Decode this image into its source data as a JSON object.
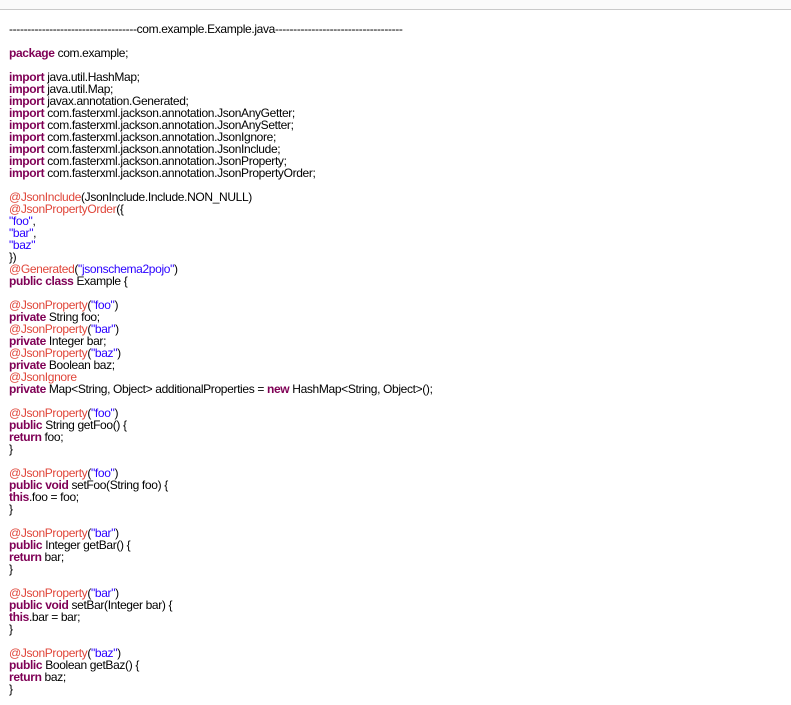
{
  "colors": {
    "keyword": "#7f0055",
    "annotation": "#e0463a",
    "string": "#2a00ff",
    "text": "#000000"
  },
  "lines": [
    [
      [
        "hd",
        "-----------------------------------com.example.Example.java-----------------------------------"
      ]
    ],
    [],
    [
      [
        "kw",
        "package"
      ],
      [
        "tx",
        " com.example;"
      ]
    ],
    [],
    [
      [
        "kw",
        "import"
      ],
      [
        "tx",
        " java.util.HashMap;"
      ]
    ],
    [
      [
        "kw",
        "import"
      ],
      [
        "tx",
        " java.util.Map;"
      ]
    ],
    [
      [
        "kw",
        "import"
      ],
      [
        "tx",
        " javax.annotation.Generated;"
      ]
    ],
    [
      [
        "kw",
        "import"
      ],
      [
        "tx",
        " com.fasterxml.jackson.annotation.JsonAnyGetter;"
      ]
    ],
    [
      [
        "kw",
        "import"
      ],
      [
        "tx",
        " com.fasterxml.jackson.annotation.JsonAnySetter;"
      ]
    ],
    [
      [
        "kw",
        "import"
      ],
      [
        "tx",
        " com.fasterxml.jackson.annotation.JsonIgnore;"
      ]
    ],
    [
      [
        "kw",
        "import"
      ],
      [
        "tx",
        " com.fasterxml.jackson.annotation.JsonInclude;"
      ]
    ],
    [
      [
        "kw",
        "import"
      ],
      [
        "tx",
        " com.fasterxml.jackson.annotation.JsonProperty;"
      ]
    ],
    [
      [
        "kw",
        "import"
      ],
      [
        "tx",
        " com.fasterxml.jackson.annotation.JsonPropertyOrder;"
      ]
    ],
    [],
    [
      [
        "an",
        "@JsonInclude"
      ],
      [
        "tx",
        "(JsonInclude.Include.NON_NULL)"
      ]
    ],
    [
      [
        "an",
        "@JsonPropertyOrder"
      ],
      [
        "tx",
        "({"
      ]
    ],
    [
      [
        "st",
        "\"foo\""
      ],
      [
        "tx",
        ","
      ]
    ],
    [
      [
        "st",
        "\"bar\""
      ],
      [
        "tx",
        ","
      ]
    ],
    [
      [
        "st",
        "\"baz\""
      ]
    ],
    [
      [
        "tx",
        "})"
      ]
    ],
    [
      [
        "an",
        "@Generated"
      ],
      [
        "tx",
        "("
      ],
      [
        "st",
        "\"jsonschema2pojo\""
      ],
      [
        "tx",
        ")"
      ]
    ],
    [
      [
        "kw",
        "public class"
      ],
      [
        "tx",
        " Example {"
      ]
    ],
    [],
    [
      [
        "an",
        "@JsonProperty"
      ],
      [
        "tx",
        "("
      ],
      [
        "st",
        "\"foo\""
      ],
      [
        "tx",
        ")"
      ]
    ],
    [
      [
        "kw",
        "private"
      ],
      [
        "tx",
        " String foo;"
      ]
    ],
    [
      [
        "an",
        "@JsonProperty"
      ],
      [
        "tx",
        "("
      ],
      [
        "st",
        "\"bar\""
      ],
      [
        "tx",
        ")"
      ]
    ],
    [
      [
        "kw",
        "private"
      ],
      [
        "tx",
        " Integer bar;"
      ]
    ],
    [
      [
        "an",
        "@JsonProperty"
      ],
      [
        "tx",
        "("
      ],
      [
        "st",
        "\"baz\""
      ],
      [
        "tx",
        ")"
      ]
    ],
    [
      [
        "kw",
        "private"
      ],
      [
        "tx",
        " Boolean baz;"
      ]
    ],
    [
      [
        "an",
        "@JsonIgnore"
      ]
    ],
    [
      [
        "kw",
        "private"
      ],
      [
        "tx",
        " Map<String, Object> additionalProperties = "
      ],
      [
        "kw",
        "new"
      ],
      [
        "tx",
        " HashMap<String, Object>();"
      ]
    ],
    [],
    [
      [
        "an",
        "@JsonProperty"
      ],
      [
        "tx",
        "("
      ],
      [
        "st",
        "\"foo\""
      ],
      [
        "tx",
        ")"
      ]
    ],
    [
      [
        "kw",
        "public"
      ],
      [
        "tx",
        " String getFoo() {"
      ]
    ],
    [
      [
        "kw",
        "return"
      ],
      [
        "tx",
        " foo;"
      ]
    ],
    [
      [
        "tx",
        "}"
      ]
    ],
    [],
    [
      [
        "an",
        "@JsonProperty"
      ],
      [
        "tx",
        "("
      ],
      [
        "st",
        "\"foo\""
      ],
      [
        "tx",
        ")"
      ]
    ],
    [
      [
        "kw",
        "public void"
      ],
      [
        "tx",
        " setFoo(String foo) {"
      ]
    ],
    [
      [
        "kw",
        "this"
      ],
      [
        "tx",
        ".foo = foo;"
      ]
    ],
    [
      [
        "tx",
        "}"
      ]
    ],
    [],
    [
      [
        "an",
        "@JsonProperty"
      ],
      [
        "tx",
        "("
      ],
      [
        "st",
        "\"bar\""
      ],
      [
        "tx",
        ")"
      ]
    ],
    [
      [
        "kw",
        "public"
      ],
      [
        "tx",
        " Integer getBar() {"
      ]
    ],
    [
      [
        "kw",
        "return"
      ],
      [
        "tx",
        " bar;"
      ]
    ],
    [
      [
        "tx",
        "}"
      ]
    ],
    [],
    [
      [
        "an",
        "@JsonProperty"
      ],
      [
        "tx",
        "("
      ],
      [
        "st",
        "\"bar\""
      ],
      [
        "tx",
        ")"
      ]
    ],
    [
      [
        "kw",
        "public void"
      ],
      [
        "tx",
        " setBar(Integer bar) {"
      ]
    ],
    [
      [
        "kw",
        "this"
      ],
      [
        "tx",
        ".bar = bar;"
      ]
    ],
    [
      [
        "tx",
        "}"
      ]
    ],
    [],
    [
      [
        "an",
        "@JsonProperty"
      ],
      [
        "tx",
        "("
      ],
      [
        "st",
        "\"baz\""
      ],
      [
        "tx",
        ")"
      ]
    ],
    [
      [
        "kw",
        "public"
      ],
      [
        "tx",
        " Boolean getBaz() {"
      ]
    ],
    [
      [
        "kw",
        "return"
      ],
      [
        "tx",
        " baz;"
      ]
    ],
    [
      [
        "tx",
        "}"
      ]
    ]
  ]
}
